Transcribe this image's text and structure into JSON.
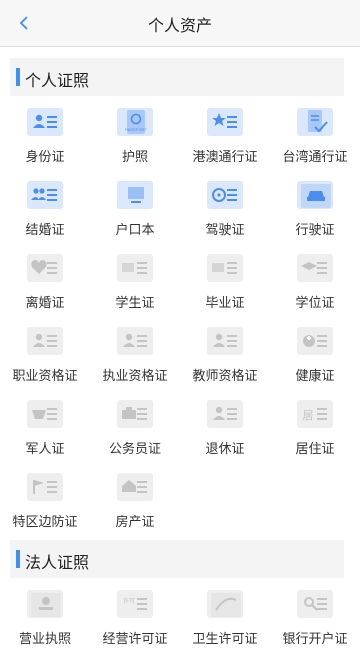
{
  "header": {
    "title": "个人资产"
  },
  "sections": [
    {
      "title": "个人证照",
      "items": [
        {
          "label": "身份证",
          "icon": "id-card-icon",
          "active": true
        },
        {
          "label": "护照",
          "icon": "passport-icon",
          "active": true,
          "icon_text": "PASSPORT"
        },
        {
          "label": "港澳通行证",
          "icon": "hk-macau-pass-icon",
          "active": true
        },
        {
          "label": "台湾通行证",
          "icon": "taiwan-pass-icon",
          "active": true
        },
        {
          "label": "结婚证",
          "icon": "marriage-cert-icon",
          "active": true
        },
        {
          "label": "户口本",
          "icon": "household-register-icon",
          "active": true
        },
        {
          "label": "驾驶证",
          "icon": "driver-license-icon",
          "active": true
        },
        {
          "label": "行驶证",
          "icon": "vehicle-license-icon",
          "active": true
        },
        {
          "label": "离婚证",
          "icon": "divorce-cert-icon",
          "active": false
        },
        {
          "label": "学生证",
          "icon": "student-id-icon",
          "active": false
        },
        {
          "label": "毕业证",
          "icon": "diploma-icon",
          "active": false
        },
        {
          "label": "学位证",
          "icon": "degree-cert-icon",
          "active": false
        },
        {
          "label": "职业资格证",
          "icon": "professional-qualification-icon",
          "active": false
        },
        {
          "label": "执业资格证",
          "icon": "practice-qualification-icon",
          "active": false
        },
        {
          "label": "教师资格证",
          "icon": "teacher-qualification-icon",
          "active": false
        },
        {
          "label": "健康证",
          "icon": "health-cert-icon",
          "active": false
        },
        {
          "label": "军人证",
          "icon": "military-id-icon",
          "active": false
        },
        {
          "label": "公务员证",
          "icon": "civil-servant-id-icon",
          "active": false
        },
        {
          "label": "退休证",
          "icon": "retirement-cert-icon",
          "active": false
        },
        {
          "label": "居住证",
          "icon": "residence-permit-icon",
          "active": false,
          "icon_text": "居"
        },
        {
          "label": "特区边防证",
          "icon": "border-pass-icon",
          "active": false
        },
        {
          "label": "房产证",
          "icon": "property-cert-icon",
          "active": false
        }
      ]
    },
    {
      "title": "法人证照",
      "items": [
        {
          "label": "营业执照",
          "icon": "business-license-icon",
          "active": false
        },
        {
          "label": "经营许可证",
          "icon": "operating-permit-icon",
          "active": false,
          "icon_text": "许可"
        },
        {
          "label": "卫生许可证",
          "icon": "hygiene-permit-icon",
          "active": false
        },
        {
          "label": "银行开户证",
          "icon": "bank-account-cert-icon",
          "active": false
        }
      ]
    }
  ],
  "colors": {
    "accent": "#3d8ff0",
    "active_icon_bg": "#dbe7fb",
    "inactive_icon_bg": "#eeeeee",
    "active_glyph": "#4a8ff0",
    "inactive_glyph": "#c4c4c4"
  }
}
